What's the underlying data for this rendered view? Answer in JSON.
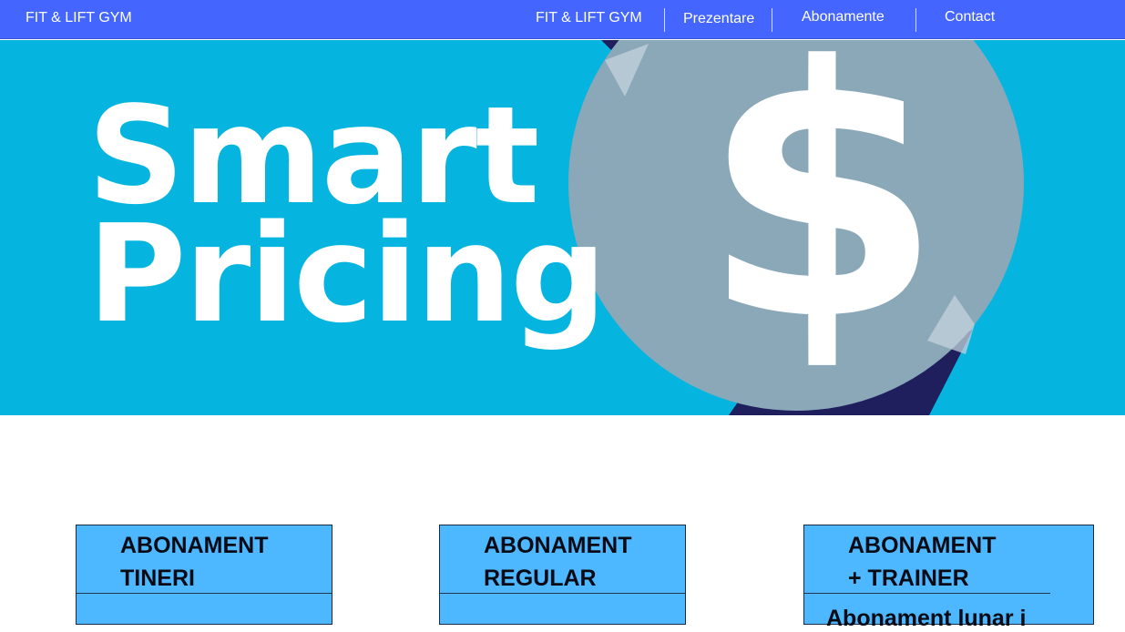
{
  "navbar": {
    "brand": "FIT & LIFT GYM",
    "links": [
      "FIT & LIFT GYM",
      "Prezentare",
      "Abonamente",
      "Contact"
    ]
  },
  "hero": {
    "line1": "Smart",
    "line2": "Pricing",
    "symbol": "$",
    "colors": {
      "background": "#05b5e0",
      "coin": "#8aa8b8",
      "tab": "#1f1f5e"
    }
  },
  "cards": [
    {
      "title": "ABONAMENT\nTINERI",
      "body": ""
    },
    {
      "title": "ABONAMENT\nREGULAR",
      "body": ""
    },
    {
      "title": "ABONAMENT\n + TRAINER",
      "body": "Abonament lunar i"
    }
  ],
  "colors": {
    "navbar": "#4466ff",
    "card": "#4db8ff"
  }
}
